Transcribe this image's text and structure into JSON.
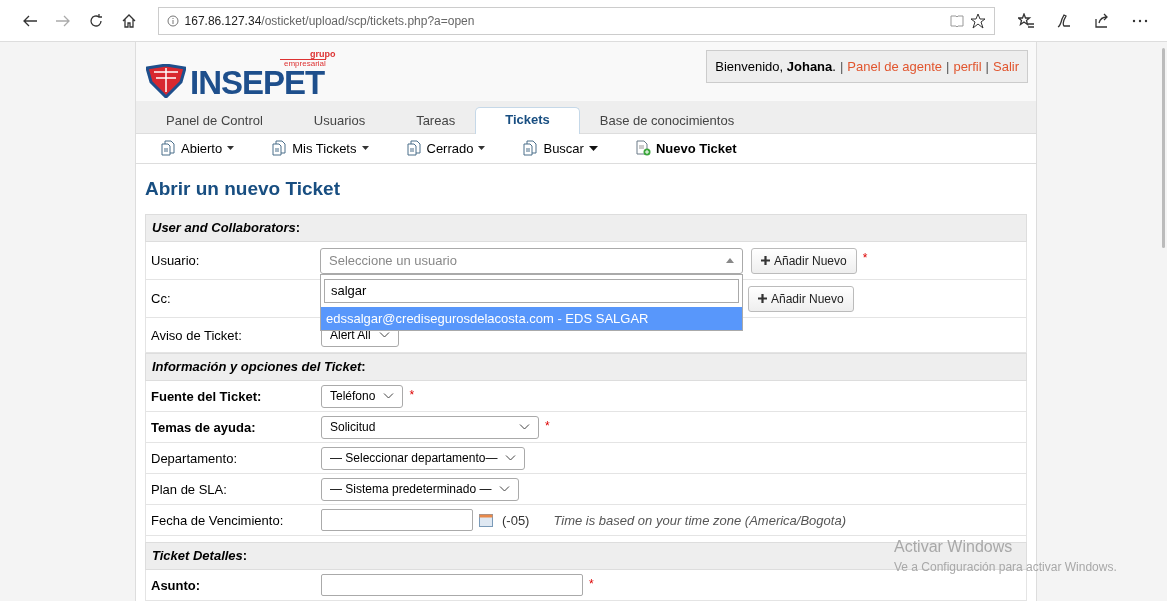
{
  "browser": {
    "url_host": "167.86.127.34",
    "url_path": "/osticket/upload/scp/tickets.php?a=open"
  },
  "header": {
    "logo_top": "grupo",
    "logo_sub": "empresarial",
    "logo": "INSEPET",
    "welcome": "Bienvenido, **Johana**.",
    "separator": "|",
    "links": [
      "Panel de agente",
      "perfil",
      "Salir"
    ]
  },
  "tabs": [
    {
      "label": "Panel de Control",
      "selected": false
    },
    {
      "label": "Usuarios",
      "selected": false
    },
    {
      "label": "Tareas",
      "selected": false
    },
    {
      "label": "Tickets",
      "selected": true
    },
    {
      "label": "Base de conocimientos",
      "selected": false
    }
  ],
  "subnav": [
    {
      "label": "Abierto",
      "kind": "menu"
    },
    {
      "label": "Mis Tickets",
      "kind": "menu"
    },
    {
      "label": "Cerrado",
      "kind": "menu"
    },
    {
      "label": "Buscar",
      "kind": "search"
    },
    {
      "label": "Nuevo Ticket",
      "kind": "new"
    }
  ],
  "page_title": "Abrir un nuevo Ticket",
  "sections": [
    {
      "title": "*User and Collaborators*:",
      "rows": [
        {
          "kind": "user",
          "label": "Usuario:",
          "placeholder": "Seleccione un usuario",
          "button": "Añadir Nuevo",
          "required_mark": "*",
          "dropdown": {
            "search": "salgar",
            "results": [
              {
                "label": "edssalgar@credisegurosdelacosta.com - EDS SALGAR",
                "selected": true
              }
            ]
          }
        },
        {
          "kind": "cc",
          "label": "Cc:",
          "button": "Añadir Nuevo"
        },
        {
          "kind": "select",
          "label": "Aviso de Ticket:",
          "value": "Alert All",
          "bold": false
        }
      ]
    },
    {
      "title": "*Información y opciones del Ticket*:",
      "rows": [
        {
          "kind": "select",
          "label": "Fuente del Ticket:",
          "value": "Teléfono",
          "bold": true,
          "required_mark": "*"
        },
        {
          "kind": "wide-select",
          "label": "Temas de ayuda:",
          "value": "Solicitud",
          "bold": true,
          "required_mark": "*"
        },
        {
          "kind": "select",
          "label": "Departamento:",
          "value": "— Seleccionar departamento—",
          "bold": false
        },
        {
          "kind": "select",
          "label": "Plan de SLA:",
          "value": "— Sistema predeterminado —",
          "bold": false
        },
        {
          "kind": "date",
          "label": "Fecha de Vencimiento:",
          "offset": "(-05)",
          "note": "Time is based on your time zone (America/Bogota)"
        }
      ]
    },
    {
      "title": "*Ticket Detalles*:",
      "rows": [
        {
          "kind": "text",
          "label": "Asunto:",
          "bold": true,
          "required_mark": "*"
        }
      ]
    }
  ],
  "os_notice": {
    "title": "Activar Windows",
    "text": "Ve a Configuración para activar Windows."
  }
}
